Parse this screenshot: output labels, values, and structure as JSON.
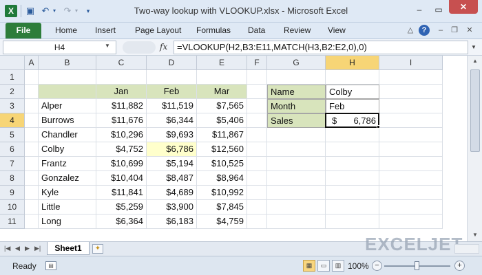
{
  "window": {
    "title": "Two-way lookup with VLOOKUP.xlsx  -  Microsoft Excel",
    "app_icon": "X",
    "min": "–",
    "max": "▭",
    "close": "✕"
  },
  "ribbon": {
    "tabs": [
      "File",
      "Home",
      "Insert",
      "Page Layout",
      "Formulas",
      "Data",
      "Review",
      "View"
    ]
  },
  "formula_bar": {
    "name_box": "H4",
    "fx": "fx",
    "formula": "=VLOOKUP(H2,B3:E11,MATCH(H3,B2:E2,0),0)"
  },
  "grid": {
    "columns": [
      "A",
      "B",
      "C",
      "D",
      "E",
      "F",
      "G",
      "H",
      "I"
    ],
    "rows": [
      "1",
      "2",
      "3",
      "4",
      "5",
      "6",
      "7",
      "8",
      "9",
      "10",
      "11"
    ],
    "selected_column": "H",
    "selected_row": "4"
  },
  "table": {
    "headers": [
      "Jan",
      "Feb",
      "Mar"
    ],
    "rows": [
      {
        "name": "Alper",
        "values": [
          "$11,882",
          "$11,519",
          "$7,565"
        ]
      },
      {
        "name": "Burrows",
        "values": [
          "$11,676",
          "$6,344",
          "$5,406"
        ]
      },
      {
        "name": "Chandler",
        "values": [
          "$10,296",
          "$9,693",
          "$11,867"
        ]
      },
      {
        "name": "Colby",
        "values": [
          "$4,752",
          "$6,786",
          "$12,560"
        ]
      },
      {
        "name": "Frantz",
        "values": [
          "$10,699",
          "$5,194",
          "$10,525"
        ]
      },
      {
        "name": "Gonzalez",
        "values": [
          "$10,404",
          "$8,487",
          "$8,964"
        ]
      },
      {
        "name": "Kyle",
        "values": [
          "$11,841",
          "$4,689",
          "$10,992"
        ]
      },
      {
        "name": "Little",
        "values": [
          "$5,259",
          "$3,900",
          "$7,845"
        ]
      },
      {
        "name": "Long",
        "values": [
          "$6,364",
          "$6,183",
          "$4,759"
        ]
      }
    ]
  },
  "lookup": {
    "name_label": "Name",
    "name_value": "Colby",
    "month_label": "Month",
    "month_value": "Feb",
    "sales_label": "Sales",
    "sales_currency": "$",
    "sales_value": "6,786"
  },
  "sheets": {
    "active": "Sheet1",
    "new_sheet_icon": "✦"
  },
  "watermark": "EXCELJET",
  "status": {
    "ready": "Ready",
    "zoom": "100%"
  },
  "zoom_level_percent": 100
}
